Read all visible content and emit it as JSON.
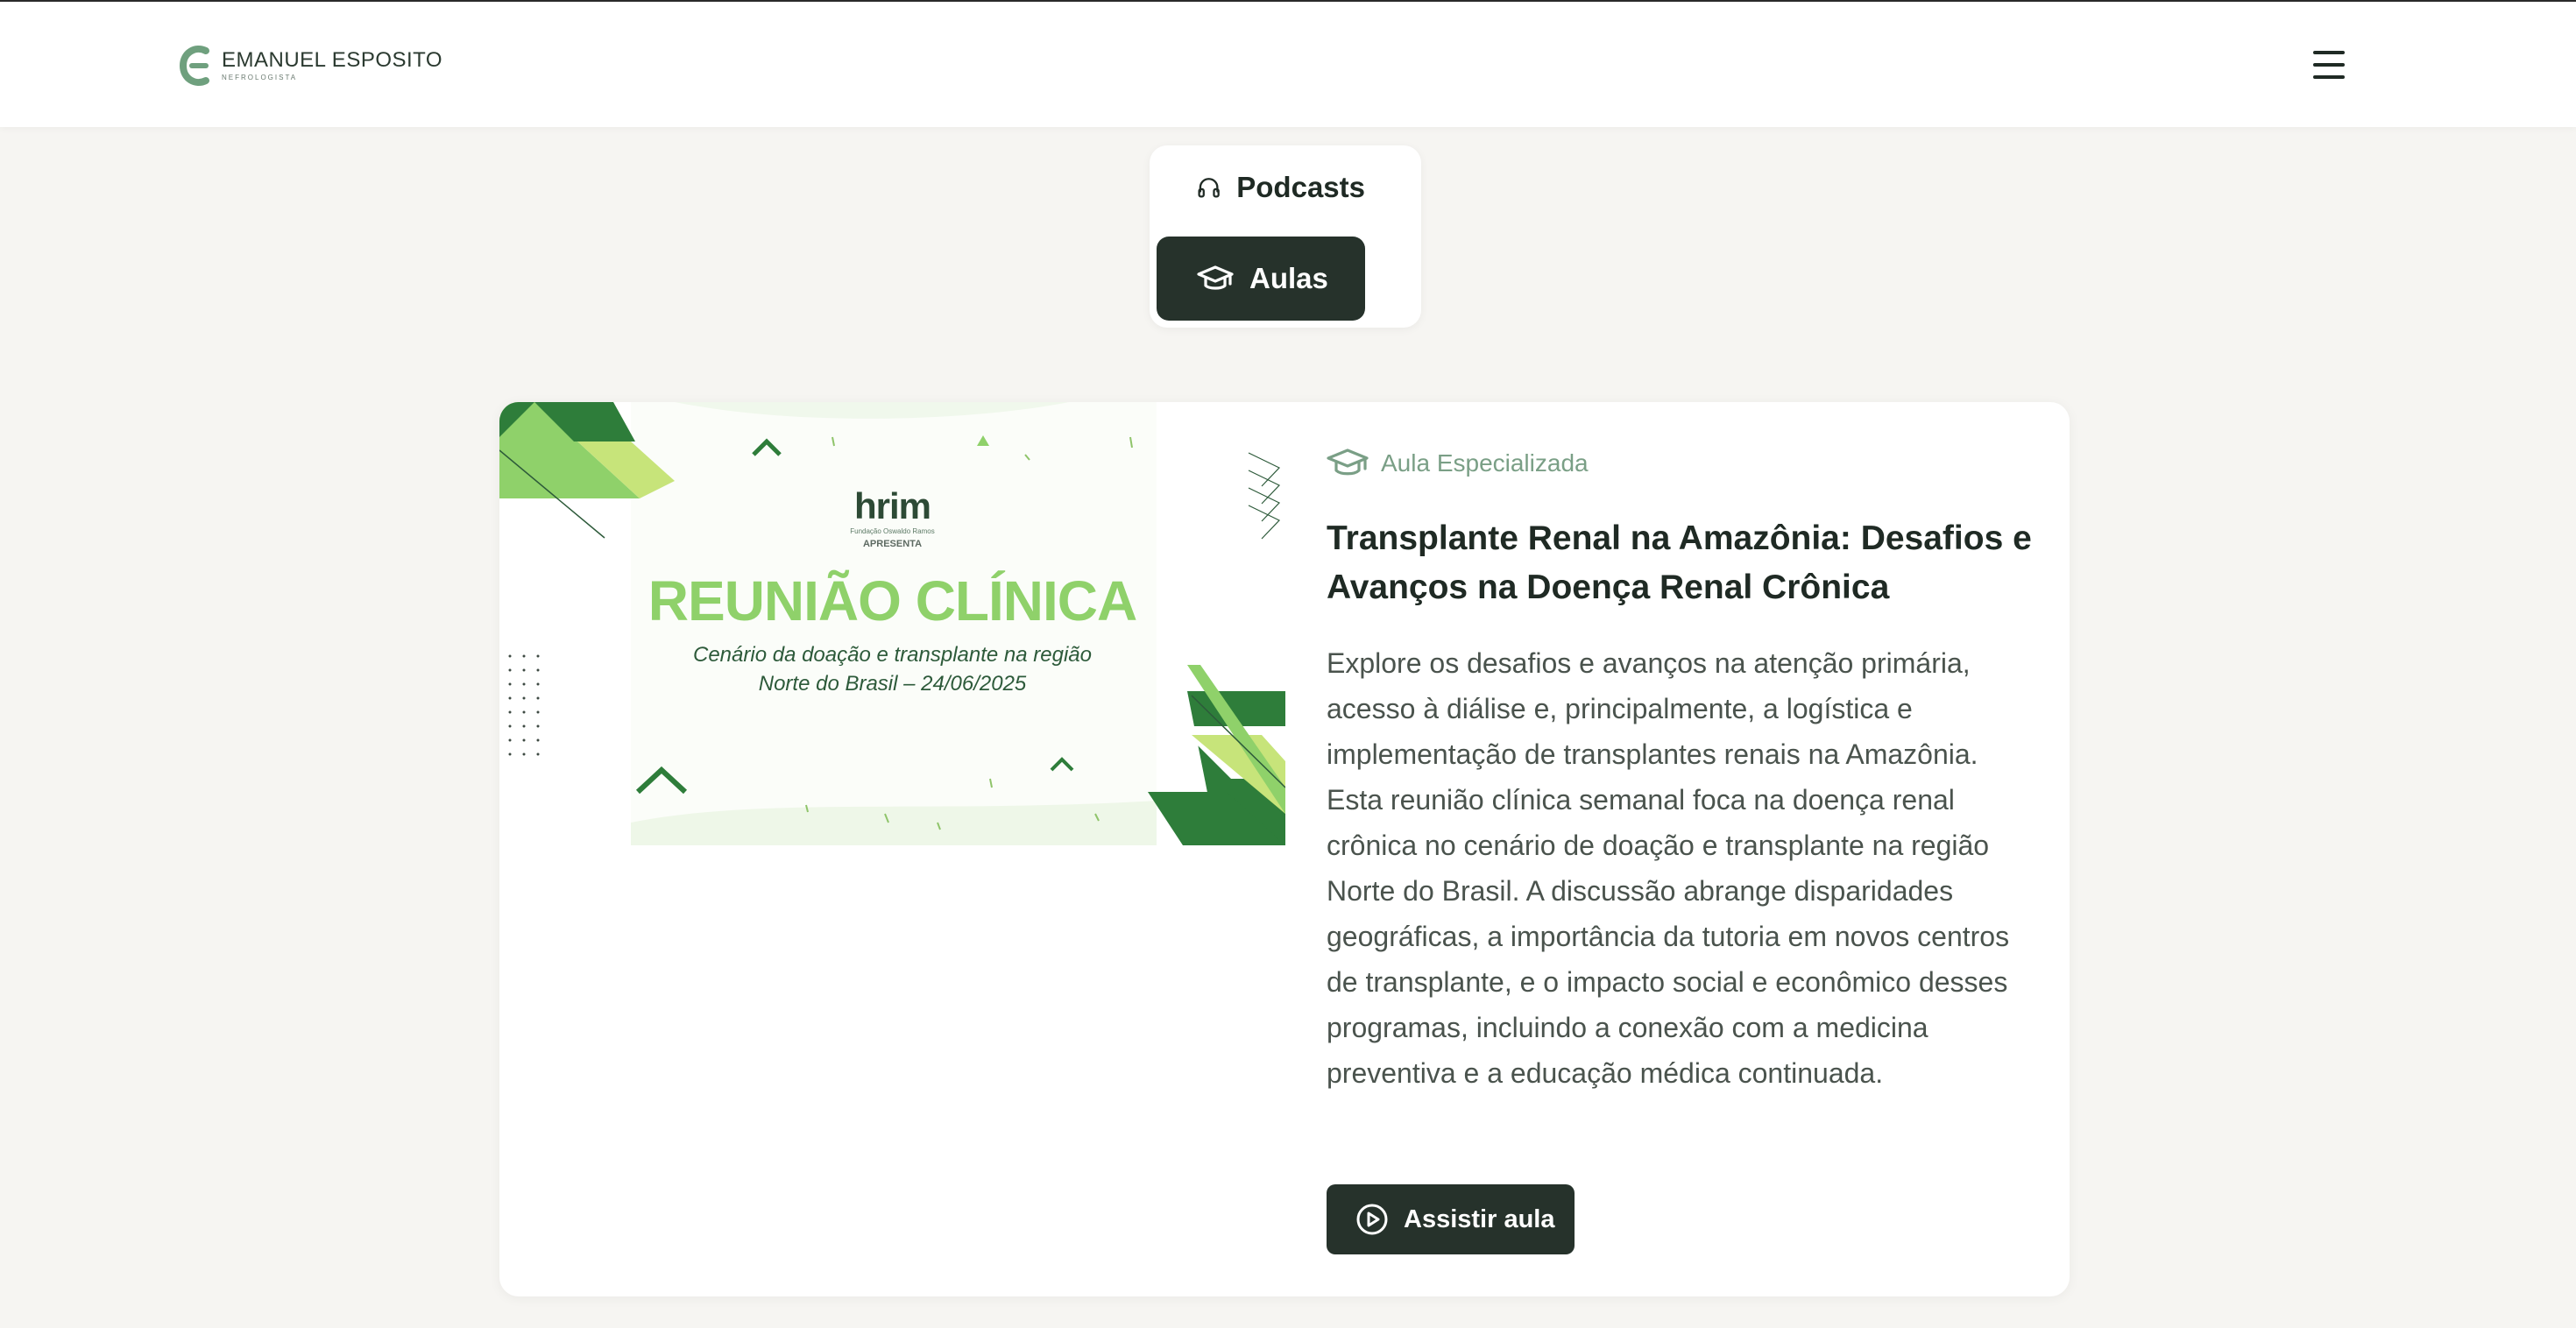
{
  "header": {
    "logo_name": "EMANUEL ESPOSITO",
    "logo_sub": "NEFROLOGISTA",
    "menu_icon": "hamburger-icon"
  },
  "tabs": [
    {
      "label": "Podcasts",
      "icon": "headphones-icon",
      "active": false
    },
    {
      "label": "Aulas",
      "icon": "graduation-cap-icon",
      "active": true
    }
  ],
  "lesson": {
    "thumbnail": {
      "brand": "hrim",
      "brand_sub": "Fundação Oswaldo Ramos",
      "brand_sub2": "APRESENTA",
      "headline": "REUNIÃO CLÍNICA",
      "subline_1": "Cenário da doação e transplante na região",
      "subline_2": "Norte do Brasil – 24/06/2025"
    },
    "badge": "Aula Especializada",
    "title": "Transplante Renal na Amazônia: Desafios e Avanços na Doença Renal Crônica",
    "description": "Explore os desafios e avanços na atenção primária, acesso à diálise e, principalmente, a logística e implementação de transplantes renais na Amazônia. Esta reunião clínica semanal foca na doença renal crônica no cenário de doação e transplante na região Norte do Brasil. A discussão abrange disparidades geográficas, a importância da tutoria em novos centros de transplante, e o impacto social e econômico desses programas, incluindo a conexão com a medicina preventiva e a educação médica continuada.",
    "cta_label": "Assistir aula"
  },
  "colors": {
    "dark": "#26322b",
    "accent_green": "#8fd16a",
    "badge_green": "#7a9f86",
    "background": "#f6f5f2"
  }
}
